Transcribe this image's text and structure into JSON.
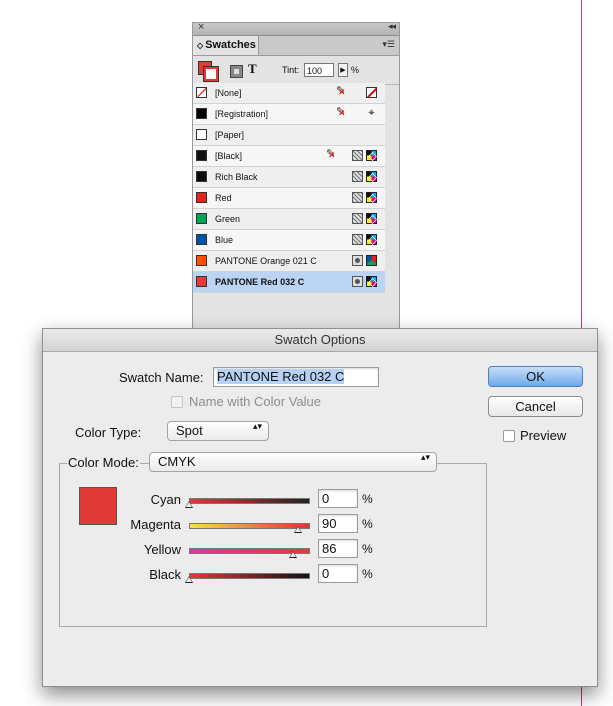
{
  "swatches_panel": {
    "close_glyph": "×",
    "collapse_glyph": "◂◂",
    "tab_label": "Swatches",
    "tab_arrows": "◇",
    "menu_glyph": "▾☰",
    "format_text_glyph": "T",
    "tint_label": "Tint:",
    "tint_value": "100",
    "tint_arrow": "▶",
    "tint_pct": "%",
    "swatches": [
      {
        "name": "[None]",
        "color": "#ffffff",
        "type": "none"
      },
      {
        "name": "[Registration]",
        "color": "#000000",
        "type": "registration"
      },
      {
        "name": "[Paper]",
        "color": "#ffffff",
        "type": "paper"
      },
      {
        "name": "[Black]",
        "color": "#111111",
        "type": "black"
      },
      {
        "name": "Rich Black",
        "color": "#0a0a0a",
        "type": "process"
      },
      {
        "name": "Red",
        "color": "#e2231a",
        "type": "process"
      },
      {
        "name": "Green",
        "color": "#00a651",
        "type": "process"
      },
      {
        "name": "Blue",
        "color": "#0054a6",
        "type": "process"
      },
      {
        "name": "PANTONE Orange 021 C",
        "color": "#fe5000",
        "type": "spot-rgb"
      },
      {
        "name": "PANTONE Red 032 C",
        "color": "#e23a36",
        "type": "spot"
      }
    ],
    "selected_index": 9
  },
  "dialog": {
    "title": "Swatch Options",
    "swatch_name_label": "Swatch Name:",
    "swatch_name_value": "PANTONE Red 032 C",
    "name_with_color_value_label": "Name with Color Value",
    "color_type_label": "Color Type:",
    "color_type_value": "Spot",
    "color_mode_label": "Color Mode:",
    "color_mode_value": "CMYK",
    "preview_color": "#e23a36",
    "ok_label": "OK",
    "cancel_label": "Cancel",
    "preview_label": "Preview",
    "updown_glyph": "▴▾",
    "pct_symbol": "%",
    "channels": [
      {
        "name": "Cyan",
        "value": "0",
        "level": 0,
        "gradient": [
          "#e23a36",
          "#222222"
        ]
      },
      {
        "name": "Magenta",
        "value": "90",
        "level": 90,
        "gradient": [
          "#f7e04a",
          "#e2312e"
        ]
      },
      {
        "name": "Yellow",
        "value": "86",
        "level": 86,
        "gradient": [
          "#d63aa0",
          "#e23a36"
        ]
      },
      {
        "name": "Black",
        "value": "0",
        "level": 0,
        "gradient": [
          "#e23a36",
          "#111111"
        ]
      }
    ]
  }
}
